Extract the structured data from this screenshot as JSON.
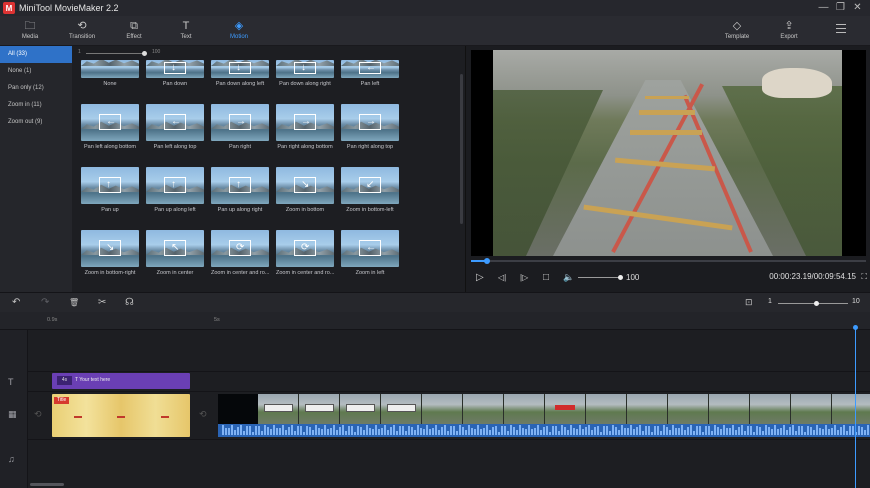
{
  "app": {
    "title": "MiniTool MovieMaker 2.2",
    "logo_letter": "M"
  },
  "window_controls": {
    "minimize": "—",
    "maximize": "❐",
    "close": "✕"
  },
  "toolbar": {
    "items": [
      {
        "label": "Media",
        "icon": "folder-icon",
        "glyph": "🗀"
      },
      {
        "label": "Transition",
        "icon": "transition-icon",
        "glyph": "⟲"
      },
      {
        "label": "Effect",
        "icon": "effect-icon",
        "glyph": "⧉"
      },
      {
        "label": "Text",
        "icon": "text-icon",
        "glyph": "T"
      },
      {
        "label": "Motion",
        "icon": "motion-icon",
        "glyph": "◈"
      }
    ],
    "active": "Motion",
    "template_label": "Template",
    "template_glyph": "◇",
    "export_label": "Export",
    "export_glyph": "⇪"
  },
  "categories": [
    {
      "label": "All (33)",
      "active": true
    },
    {
      "label": "None (1)"
    },
    {
      "label": "Pan only (12)"
    },
    {
      "label": "Zoom in (11)"
    },
    {
      "label": "Zoom out (9)"
    }
  ],
  "library_slider": {
    "min_label": "1",
    "max_label": "100"
  },
  "motions": {
    "row1": [
      "None",
      "Pan down",
      "Pan down along left",
      "Pan down along right",
      "Pan left"
    ],
    "row2": [
      "Pan left along bottom",
      "Pan left along top",
      "Pan right",
      "Pan right along bottom",
      "Pan right along top"
    ],
    "row3": [
      "Pan up",
      "Pan up along left",
      "Pan up along right",
      "Zoom in bottom",
      "Zoom in bottom-left"
    ],
    "row4": [
      "Zoom in bottom-right",
      "Zoom in center",
      "Zoom in center and ro...",
      "Zoom in center and ro...",
      "Zoom in left"
    ]
  },
  "player": {
    "volume": "100",
    "volume_level": 1.0,
    "progress_fraction": 0.04,
    "timecode": "00:00:23.19/00:09:54.15",
    "play_glyph": "▷",
    "prev_glyph": "◁|",
    "next_glyph": "|▷",
    "stop_glyph": "□",
    "volume_glyph": "🔈",
    "fullscreen_glyph": "⛶"
  },
  "timeline_toolbar": {
    "undo": "↶",
    "redo": "↷",
    "delete": "🗑",
    "split": "✂",
    "audio": "☊",
    "fit_glyph": "⊡",
    "zoom_min": "1",
    "zoom_max": "10"
  },
  "ruler": {
    "marks": [
      "0.9s",
      "5s"
    ]
  },
  "tracks": {
    "text_glyph": "T",
    "video_glyph": "▦",
    "music_glyph": "♫",
    "text_clip": {
      "duration": "4s",
      "label": "T  Your text here"
    },
    "title_clip": {
      "badge": "Title"
    }
  },
  "colors": {
    "accent": "#3d9bff",
    "active_category": "#2f72c8",
    "text_clip": "#6a3fb4",
    "title_badge": "#d63a2e"
  }
}
